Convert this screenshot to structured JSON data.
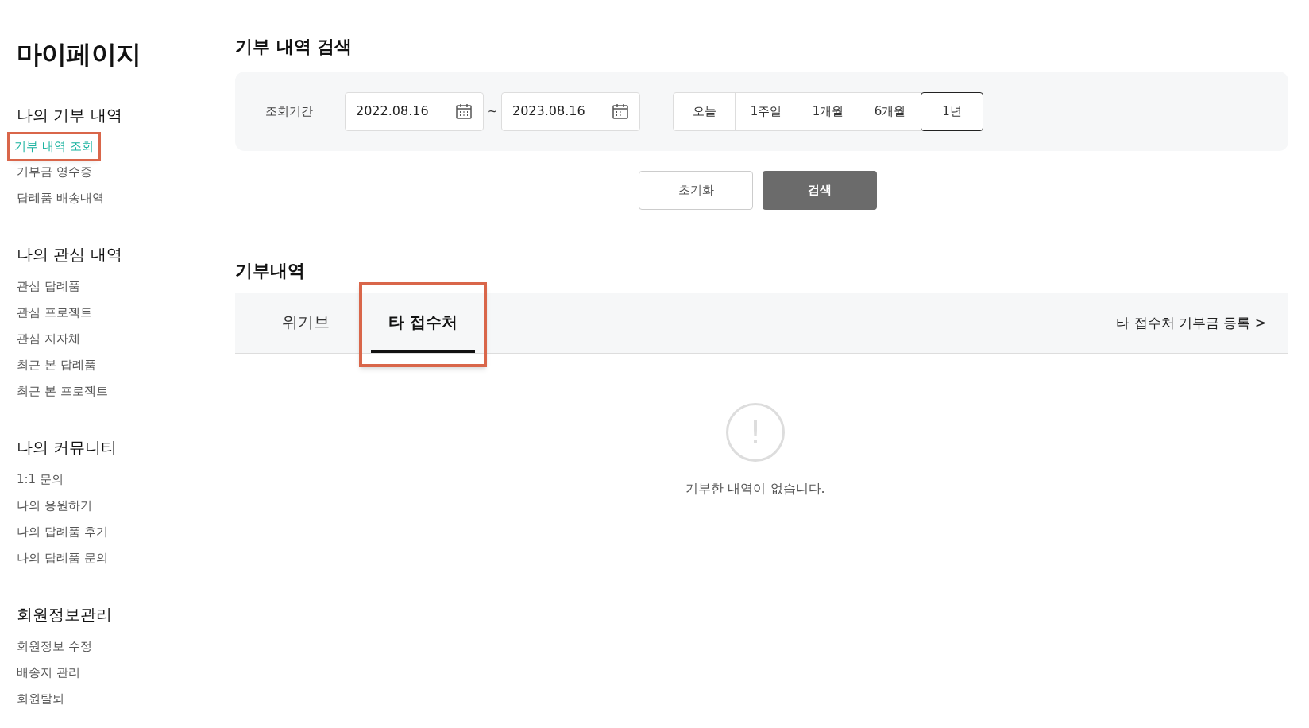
{
  "sidebar": {
    "title": "마이페이지",
    "sections": [
      {
        "heading": "나의 기부 내역",
        "items": [
          {
            "label": "기부 내역 조회",
            "selected": true,
            "highlighted": true
          },
          {
            "label": "기부금 영수증",
            "selected": false,
            "highlighted": false
          },
          {
            "label": "답례품 배송내역",
            "selected": false,
            "highlighted": false
          }
        ]
      },
      {
        "heading": "나의 관심 내역",
        "items": [
          {
            "label": "관심 답례품",
            "selected": false,
            "highlighted": false
          },
          {
            "label": "관심 프로젝트",
            "selected": false,
            "highlighted": false
          },
          {
            "label": "관심 지자체",
            "selected": false,
            "highlighted": false
          },
          {
            "label": "최근 본 답례품",
            "selected": false,
            "highlighted": false
          },
          {
            "label": "최근 본 프로젝트",
            "selected": false,
            "highlighted": false
          }
        ]
      },
      {
        "heading": "나의 커뮤니티",
        "items": [
          {
            "label": "1:1 문의",
            "selected": false,
            "highlighted": false
          },
          {
            "label": "나의 응원하기",
            "selected": false,
            "highlighted": false
          },
          {
            "label": "나의 답례품 후기",
            "selected": false,
            "highlighted": false
          },
          {
            "label": "나의 답례품 문의",
            "selected": false,
            "highlighted": false
          }
        ]
      },
      {
        "heading": "회원정보관리",
        "items": [
          {
            "label": "회원정보 수정",
            "selected": false,
            "highlighted": false
          },
          {
            "label": "배송지 관리",
            "selected": false,
            "highlighted": false
          },
          {
            "label": "회원탈퇴",
            "selected": false,
            "highlighted": false
          }
        ]
      }
    ]
  },
  "search": {
    "heading": "기부 내역 검색",
    "period_label": "조회기간",
    "start_date": "2022.08.16",
    "separator": "~",
    "end_date": "2023.08.16",
    "periods": [
      {
        "label": "오늘",
        "selected": false
      },
      {
        "label": "1주일",
        "selected": false
      },
      {
        "label": "1개월",
        "selected": false
      },
      {
        "label": "6개월",
        "selected": false
      },
      {
        "label": "1년",
        "selected": true
      }
    ],
    "reset_button": "초기화",
    "search_button": "검색"
  },
  "history": {
    "heading": "기부내역",
    "tabs": [
      {
        "label": "위기브",
        "selected": false,
        "highlighted": false
      },
      {
        "label": "타 접수처",
        "selected": true,
        "highlighted": true
      }
    ],
    "register_link": "타 접수처 기부금 등록 >",
    "empty_icon": "!",
    "empty_message": "기부한 내역이 없습니다."
  }
}
